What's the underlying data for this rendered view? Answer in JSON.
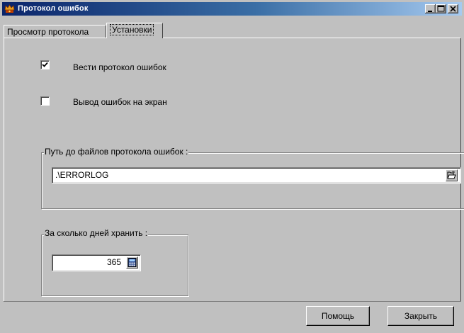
{
  "window": {
    "title": "Протокол ошибок",
    "title_icon": "crown-app-icon"
  },
  "tabs": [
    {
      "label": "Просмотр протокола",
      "active": false
    },
    {
      "label": "Установки",
      "active": true
    }
  ],
  "settings": {
    "log_errors": {
      "label": "Вести протокол ошибок",
      "checked": true
    },
    "show_on_screen": {
      "label": "Вывод ошибок на экран",
      "checked": false
    },
    "path_group": {
      "title": "Путь до файлов протокола ошибок :",
      "value": ".\\ERRORLOG",
      "browse_icon": "open-folder-icon"
    },
    "days_group": {
      "title": "За сколько дней хранить :",
      "value": "365",
      "calc_icon": "calculator-icon"
    }
  },
  "buttons": {
    "help": "Помощь",
    "close": "Закрыть"
  },
  "colors": {
    "face": "#c0c0c0",
    "titlebar_start": "#0a246a",
    "titlebar_end": "#a6caf0"
  }
}
